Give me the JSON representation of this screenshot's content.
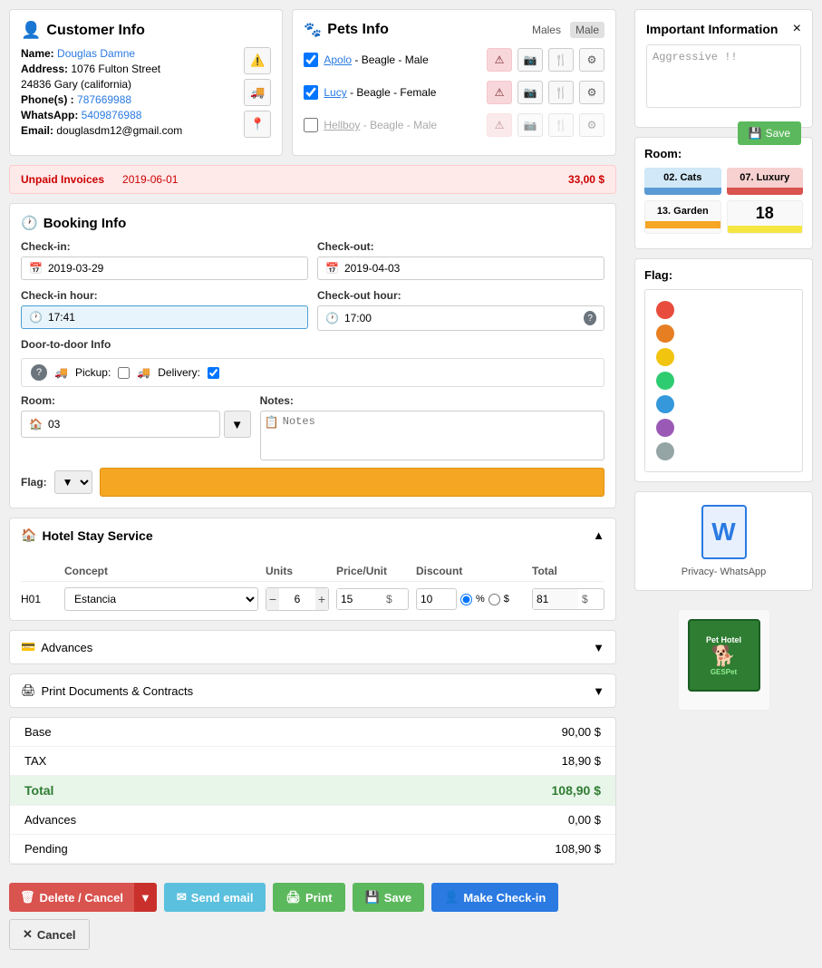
{
  "customer": {
    "section_title": "Customer Info",
    "name_label": "Name:",
    "name_value": "Douglas Damne",
    "address_label": "Address:",
    "address_value": "1076 Fulton Street",
    "city_value": "24836 Gary (california)",
    "phone_label": "Phone(s) :",
    "phone_value": "787669988",
    "whatsapp_label": "WhatsApp:",
    "whatsapp_value": "5409876988",
    "email_label": "Email:",
    "email_value": "douglasdm12@gmail.com"
  },
  "pets": {
    "section_title": "Pets Info",
    "gender_label": "Males",
    "gender_filter": "Male",
    "items": [
      {
        "name": "Apolo",
        "breed": "Beagle",
        "gender": "Male",
        "checked": true
      },
      {
        "name": "Lucy",
        "breed": "Beagle",
        "gender": "Female",
        "checked": true
      },
      {
        "name": "Hellboy",
        "breed": "Beagle",
        "gender": "Male",
        "checked": false
      }
    ]
  },
  "unpaid": {
    "label": "Unpaid Invoices",
    "date": "2019-06-01",
    "amount": "33,00 $"
  },
  "booking": {
    "section_title": "Booking Info",
    "checkin_label": "Check-in:",
    "checkin_value": "2019-03-29",
    "checkout_label": "Check-out:",
    "checkout_value": "2019-04-03",
    "checkin_hour_label": "Check-in hour:",
    "checkin_hour_value": "17:41",
    "checkout_hour_label": "Check-out hour:",
    "checkout_hour_value": "17:00",
    "door_label": "Door-to-door Info",
    "pickup_label": "Pickup:",
    "delivery_label": "Delivery:",
    "room_label": "Room:",
    "room_value": "03",
    "notes_label": "Notes:",
    "notes_placeholder": "Notes",
    "flag_label": "Flag:"
  },
  "hotel_service": {
    "title": "Hotel Stay Service",
    "col_concept": "Concept",
    "col_units": "Units",
    "col_price": "Price/Unit",
    "col_discount": "Discount",
    "col_total": "Total",
    "row": {
      "code": "H01",
      "concept": "Estancia",
      "units": "6",
      "price": "15",
      "discount": "10",
      "discount_type": "%",
      "total": "81"
    }
  },
  "advances": {
    "title": "Advances"
  },
  "print": {
    "title": "Print Documents & Contracts"
  },
  "summary": {
    "base_label": "Base",
    "base_value": "90,00 $",
    "tax_label": "TAX",
    "tax_value": "18,90 $",
    "total_label": "Total",
    "total_value": "108,90 $",
    "advances_label": "Advances",
    "advances_value": "0,00 $",
    "pending_label": "Pending",
    "pending_value": "108,90 $"
  },
  "actions": {
    "delete_label": "Delete / Cancel",
    "send_email_label": "Send email",
    "print_label": "Print",
    "save_label": "Save",
    "checkin_label": "Make Check-in",
    "cancel_label": "Cancel"
  },
  "right_panel": {
    "important_title": "Important Information",
    "important_close": "×",
    "important_text": "Aggressive !!",
    "save_label": "Save",
    "room_title": "Room:",
    "rooms": [
      {
        "name": "02. Cats",
        "color": "blue"
      },
      {
        "name": "07. Luxury",
        "color": "pink"
      },
      {
        "name": "13. Garden",
        "color": "orange"
      },
      {
        "name": "18",
        "color": "yellow"
      }
    ],
    "flag_title": "Flag:",
    "flags": [
      "#e74c3c",
      "#e67e22",
      "#f1c40f",
      "#2ecc71",
      "#3498db",
      "#9b59b6",
      "#95a5a6"
    ],
    "doc_label": "Privacy- WhatsApp",
    "doc_icon": "W"
  }
}
